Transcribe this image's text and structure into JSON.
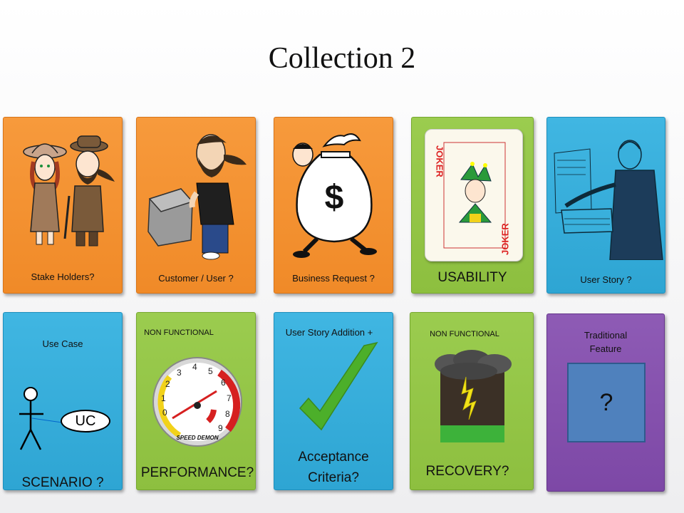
{
  "slide": {
    "title": "Collection 2"
  },
  "cards": {
    "stakeholders": {
      "label": "Stake Holders?"
    },
    "customer": {
      "label": "Customer / User ?"
    },
    "business": {
      "label": "Business Request ?",
      "symbol": "$"
    },
    "usability": {
      "label": "USABILITY",
      "joker_text": "JOKER"
    },
    "userstory": {
      "label": "User Story ?"
    },
    "usecase": {
      "label": "Use Case",
      "bubble": "UC",
      "bottom": "SCENARIO ?"
    },
    "performance": {
      "header": "NON FUNCTIONAL",
      "bottom": "PERFORMANCE?",
      "gauge_text": "SPEED DEMON",
      "gauge_ticks": [
        "0",
        "1",
        "2",
        "3",
        "4",
        "5",
        "6",
        "7",
        "8",
        "9"
      ]
    },
    "acceptance": {
      "header": "User Story Addition +",
      "bottom_line1": "Acceptance",
      "bottom_line2": "Criteria?"
    },
    "recovery": {
      "header": "NON FUNCTIONAL",
      "bottom": "RECOVERY?"
    },
    "traditional": {
      "line1": "Traditional",
      "line2": "Feature",
      "box": "?"
    }
  },
  "colors": {
    "orange": "#f08a28",
    "blue": "#2ea5d3",
    "green": "#8dbf3f",
    "purple": "#7d48a6",
    "box_blue": "#4f81bd"
  }
}
